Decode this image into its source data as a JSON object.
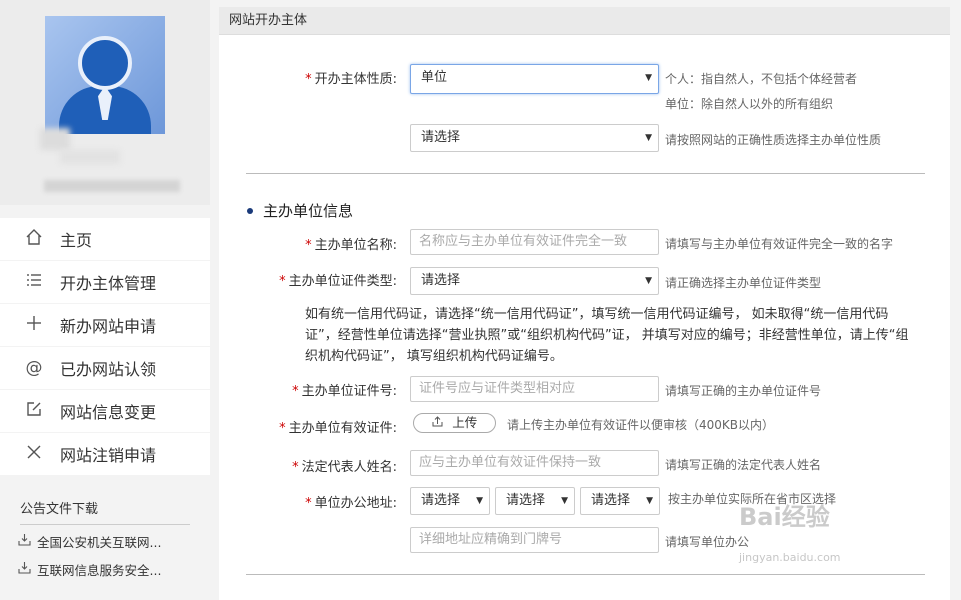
{
  "sidebar": {
    "nav": [
      {
        "label": "主页",
        "icon": "home-icon"
      },
      {
        "label": "开办主体管理",
        "icon": "list-icon"
      },
      {
        "label": "新办网站申请",
        "icon": "plus-icon"
      },
      {
        "label": "已办网站认领",
        "icon": "at-icon"
      },
      {
        "label": "网站信息变更",
        "icon": "edit-icon"
      },
      {
        "label": "网站注销申请",
        "icon": "close-icon"
      }
    ],
    "notice_title": "公告文件下载",
    "notices": [
      {
        "label": "全国公安机关互联网..."
      },
      {
        "label": "互联网信息服务安全..."
      }
    ]
  },
  "main": {
    "header": "网站开办主体",
    "owner_type": {
      "label": "开办主体性质:",
      "value": "单位",
      "hint1": "个人：指自然人，不包括个体经营者",
      "hint2": "单位：除自然人以外的所有组织",
      "sub_value": "请选择",
      "sub_hint": "请按照网站的正确性质选择主办单位性质"
    },
    "section_title": "主办单位信息",
    "unit_name": {
      "label": "主办单位名称:",
      "placeholder": "名称应与主办单位有效证件完全一致",
      "hint": "请填写与主办单位有效证件完全一致的名字"
    },
    "cert_type": {
      "label": "主办单位证件类型:",
      "value": "请选择",
      "hint": "请正确选择主办单位证件类型"
    },
    "cert_paragraph": "如有统一信用代码证，请选择“统一信用代码证”，填写统一信用代码证编号， 如未取得“统一信用代码证”，经营性单位请选择“营业执照”或“组织机构代码”证， 并填写对应的编号；非经营性单位，请上传“组织机构代码证”， 填写组织机构代码证编号。",
    "cert_no": {
      "label": "主办单位证件号:",
      "placeholder": "证件号应与证件类型相对应",
      "hint": "请填写正确的主办单位证件号"
    },
    "cert_file": {
      "label": "主办单位有效证件:",
      "button": "上传",
      "hint": "请上传主办单位有效证件以便审核（400KB以内）"
    },
    "legal_rep": {
      "label": "法定代表人姓名:",
      "placeholder": "应与主办单位有效证件保持一致",
      "hint": "请填写正确的法定代表人姓名"
    },
    "address": {
      "label": "单位办公地址:",
      "province": "请选择",
      "city": "请选择",
      "district": "请选择",
      "hint": "按主办单位实际所在省市区选择",
      "detail_placeholder": "详细地址应精确到门牌号",
      "detail_hint": "请填写单位办公"
    }
  },
  "watermark": "Bai经验",
  "watermark_url": "jingyan.baidu.com",
  "colors": {
    "required": "#cc0000",
    "active_border": "#7aa6e6",
    "avatar": "#1f5fb8"
  }
}
